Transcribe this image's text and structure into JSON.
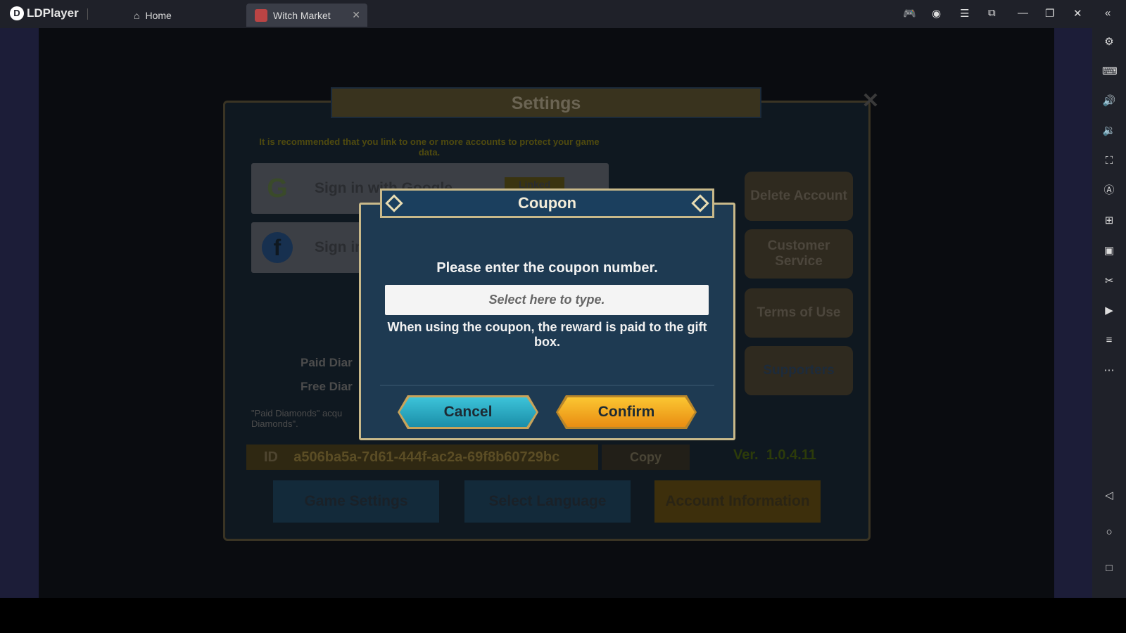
{
  "app": {
    "name": "LDPlayer",
    "tabs": [
      {
        "label": "Home",
        "icon": "home-icon"
      },
      {
        "label": "Witch Market",
        "icon": "game-icon"
      }
    ]
  },
  "settings": {
    "title": "Settings",
    "recommendation": "It is recommended that you link to one or more accounts to protect your game data.",
    "sign_in_google": "Sign in with Google",
    "linked": "Linked",
    "sign_in_facebook": "Sign in",
    "side_buttons": [
      "Delete Account",
      "Customer Service",
      "Terms of Use",
      "Supporters"
    ],
    "paid_diamonds": "Paid Diar",
    "free_diamonds": "Free Diar",
    "note": "\"Paid Diamonds\" acqu Diamonds\".",
    "id_label": "ID",
    "id_value": "a506ba5a-7d61-444f-ac2a-69f8b60729bc",
    "copy": "Copy",
    "version_label": "Ver.",
    "version": "1.0.4.11",
    "bottom_tabs": [
      "Game Settings",
      "Select Language",
      "Account Information"
    ]
  },
  "coupon": {
    "title": "Coupon",
    "prompt": "Please enter the coupon number.",
    "placeholder": "Select here to type.",
    "info": "When using the coupon, the reward is paid to the gift box.",
    "cancel": "Cancel",
    "confirm": "Confirm"
  },
  "colors": {
    "cancel": "#2bb0c8",
    "confirm": "#f2a41f",
    "dialog": "#1e3a52",
    "border": "#c9b98a"
  }
}
